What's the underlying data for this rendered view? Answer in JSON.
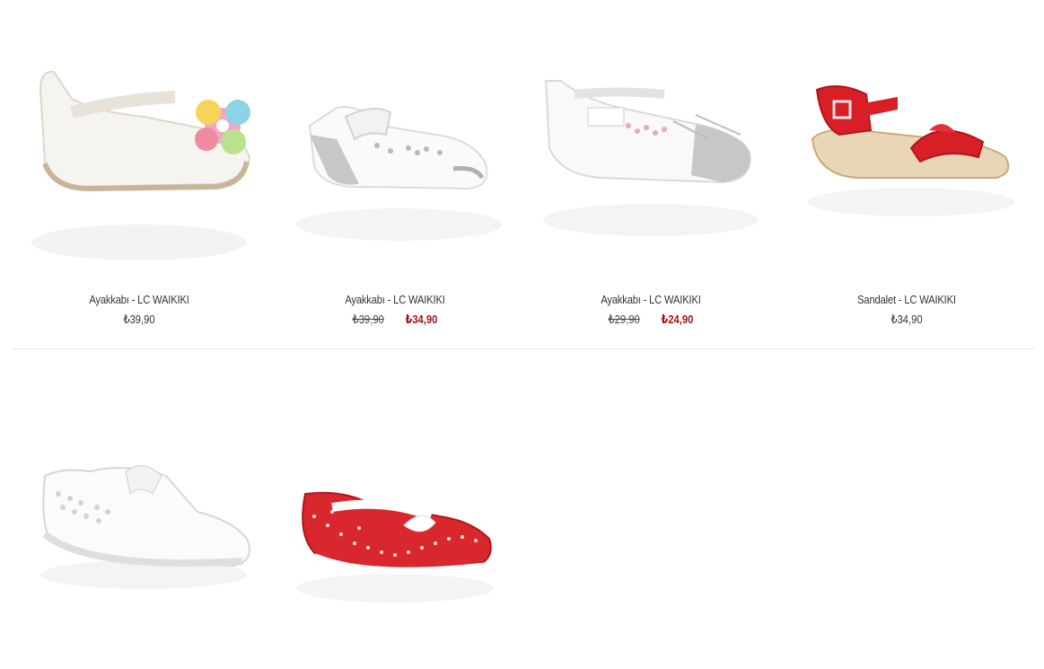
{
  "products": [
    {
      "title": "Ayakkabı - LC WAIKIKI",
      "price": "₺39,90",
      "old_price": "",
      "sale_price": "",
      "image": "white-mary-jane-flower-shoe"
    },
    {
      "title": "Ayakkabı - LC WAIKIKI",
      "price": "",
      "old_price": "₺39,90",
      "sale_price": "₺34,90",
      "image": "white-silver-butterfly-shoe"
    },
    {
      "title": "Ayakkabı - LC WAIKIKI",
      "price": "",
      "old_price": "₺29,90",
      "sale_price": "₺24,90",
      "image": "white-silver-toe-ballerina"
    },
    {
      "title": "Sandalet - LC WAIKIKI",
      "price": "₺34,90",
      "old_price": "",
      "sale_price": "",
      "image": "red-patent-sandal"
    },
    {
      "title": "",
      "price": "",
      "old_price": "",
      "sale_price": "",
      "image": "white-studded-sneaker"
    },
    {
      "title": "",
      "price": "",
      "old_price": "",
      "sale_price": "",
      "image": "red-polka-dot-slip-on"
    }
  ],
  "colors": {
    "sale": "#aa1111",
    "text": "#333333",
    "divider": "#e3e3e3"
  }
}
